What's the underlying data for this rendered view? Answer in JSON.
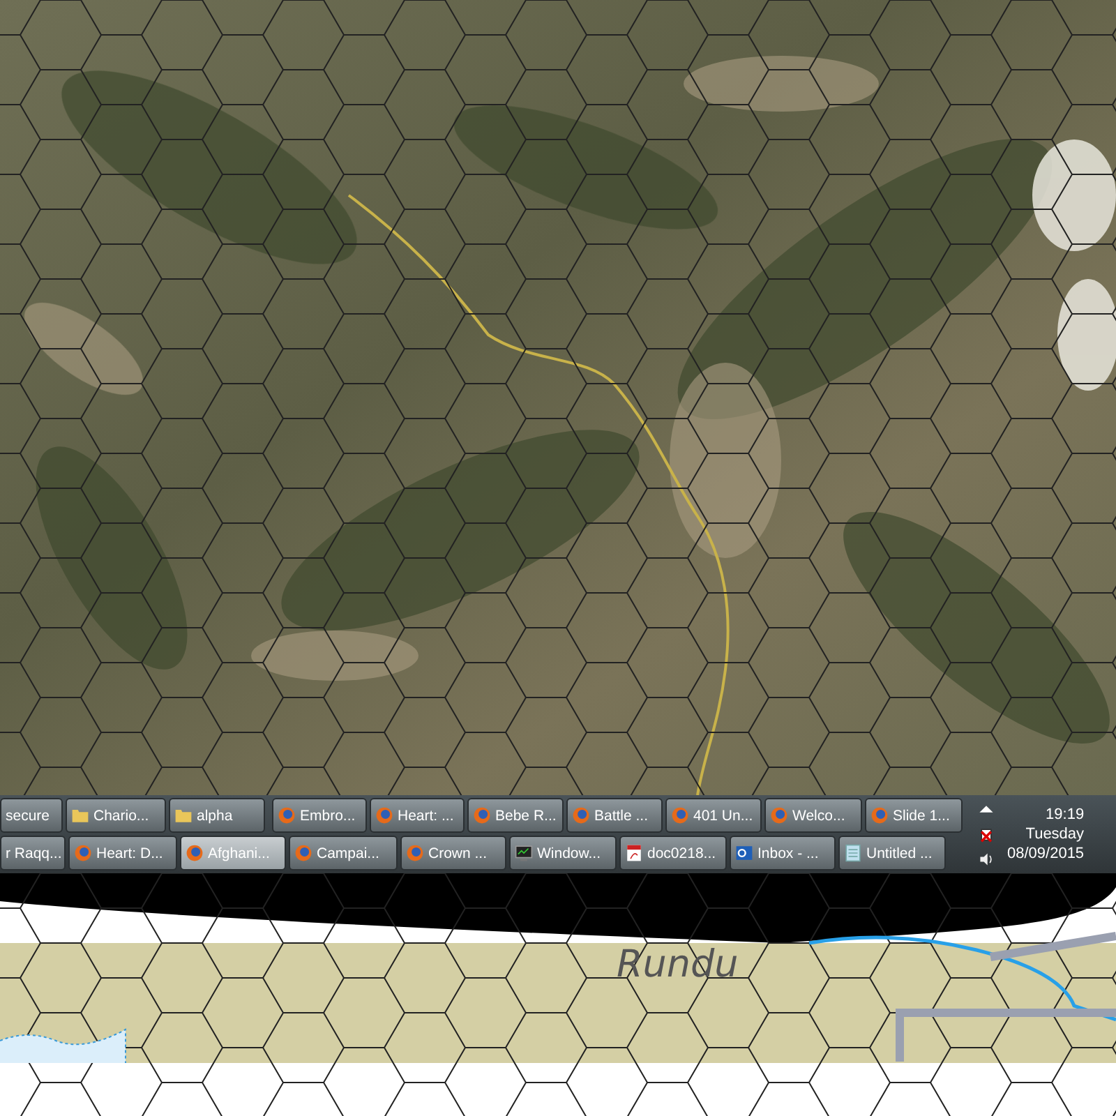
{
  "taskbar": {
    "buttons": [
      {
        "label": "secure",
        "kind": "plain",
        "selected": false
      },
      {
        "label": "Chario...",
        "kind": "folder",
        "selected": false
      },
      {
        "label": "alpha",
        "kind": "folder",
        "selected": false
      },
      {
        "label": "Embro...",
        "kind": "browser",
        "selected": false
      },
      {
        "label": "Heart: ...",
        "kind": "browser",
        "selected": false
      },
      {
        "label": "Bebe R...",
        "kind": "browser",
        "selected": false
      },
      {
        "label": "Battle ...",
        "kind": "browser",
        "selected": false
      },
      {
        "label": "401 Un...",
        "kind": "browser",
        "selected": false
      },
      {
        "label": "Welco...",
        "kind": "browser",
        "selected": false
      },
      {
        "label": "Slide 1...",
        "kind": "browser",
        "selected": false
      },
      {
        "label": "r Raqq...",
        "kind": "plain",
        "selected": false
      },
      {
        "label": "Heart: D...",
        "kind": "browser",
        "selected": false
      },
      {
        "label": "Afghani...",
        "kind": "browser",
        "selected": true
      },
      {
        "label": "Campai...",
        "kind": "browser",
        "selected": false
      },
      {
        "label": "Crown ...",
        "kind": "browser",
        "selected": false
      },
      {
        "label": "Window...",
        "kind": "terminal",
        "selected": false
      },
      {
        "label": "doc0218...",
        "kind": "pdf",
        "selected": false
      },
      {
        "label": "Inbox - ...",
        "kind": "mail",
        "selected": false
      },
      {
        "label": "Untitled ...",
        "kind": "notepad",
        "selected": false
      }
    ],
    "tray": {
      "time": "19:19",
      "day": "Tuesday",
      "date": "08/09/2015"
    }
  },
  "map": {
    "place_label": "Rundu"
  }
}
